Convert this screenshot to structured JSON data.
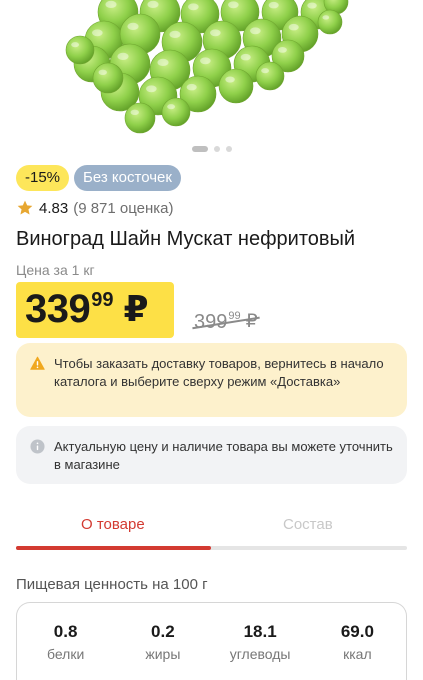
{
  "product": {
    "image_icon": "grapes-image",
    "carousel": {
      "total": 3,
      "active": 0
    },
    "badges": {
      "discount": "-15%",
      "tag": "Без косточек"
    },
    "rating": {
      "value": "4.83",
      "count": "(9 871 оценка)",
      "stars": 1
    },
    "title": "Виноград Шайн Мускат нефритовый",
    "unit_label": "Цена за 1 кг",
    "price": {
      "main": "339",
      "cents": "99",
      "currency": "₽"
    },
    "old_price": {
      "main": "399",
      "cents": "99",
      "currency": "₽"
    }
  },
  "notices": {
    "delivery": "Чтобы заказать доставку товаров, вернитесь в начало каталога и выберите сверху режим «Доставка»",
    "info": "Актуальную цену и наличие товара вы можете уточнить в магазине"
  },
  "tabs": {
    "about": "О товаре",
    "composition": "Состав",
    "active_index": 0
  },
  "nutrition": {
    "title": "Пищевая ценность на 100 г",
    "items": [
      {
        "value": "0.8",
        "label": "белки"
      },
      {
        "value": "0.2",
        "label": "жиры"
      },
      {
        "value": "18.1",
        "label": "углеводы"
      },
      {
        "value": "69.0",
        "label": "ккал"
      }
    ]
  },
  "colors": {
    "accent_red": "#d33a31",
    "price_yellow": "#fde046",
    "badge_yellow": "#fde65a",
    "badge_blue": "#9ab0c9",
    "warn_bg": "#fdf1cc",
    "info_bg": "#f2f3f5",
    "grape_green": "#8fd04a"
  }
}
